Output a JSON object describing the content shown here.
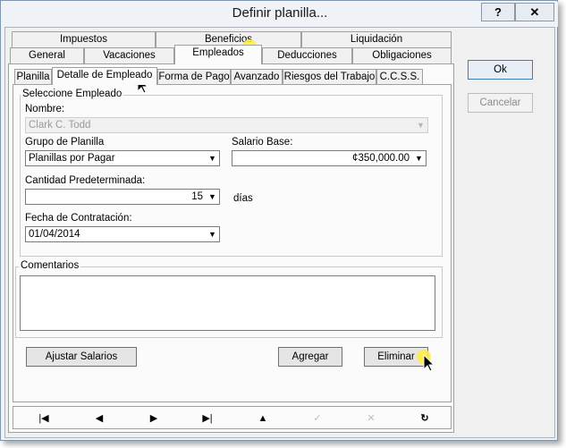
{
  "window": {
    "title": "Definir planilla...",
    "help_label": "?",
    "close_label": "✕"
  },
  "tabs_row1": [
    "Impuestos",
    "Beneficios",
    "Liquidación"
  ],
  "tabs_row2": [
    "General",
    "Vacaciones",
    "Empleados",
    "Deducciones",
    "Obligaciones"
  ],
  "subtabs": [
    "Planilla",
    "Detalle de Empleado",
    "Forma de Pago",
    "Avanzado",
    "Riesgos del Trabajo",
    "C.C.S.S."
  ],
  "group_empleado": {
    "title": "Seleccione Empleado",
    "nombre_label": "Nombre:",
    "nombre_value": "Clark C. Todd",
    "grupo_label": "Grupo de Planilla",
    "grupo_value": "Planillas por Pagar",
    "salario_label": "Salario Base:",
    "salario_value": "¢350,000.00",
    "cantidad_label": "Cantidad Predeterminada:",
    "cantidad_value": "15",
    "cantidad_unit": "días",
    "fecha_label": "Fecha de Contratación:",
    "fecha_value": "01/04/2014"
  },
  "comentarios": {
    "title": "Comentarios",
    "value": ""
  },
  "buttons": {
    "ajustar": "Ajustar Salarios",
    "agregar": "Agregar",
    "eliminar": "Eliminar",
    "ok": "Ok",
    "cancelar": "Cancelar"
  },
  "nav_icons": [
    "first-icon",
    "prev-icon",
    "next-icon",
    "last-icon",
    "up-icon",
    "confirm-icon",
    "cancel-icon",
    "refresh-icon"
  ],
  "colors": {
    "window_bg": "#eff2f7",
    "panel_bg": "#fbfbfb",
    "cursor_highlight": "#ffef3a"
  }
}
